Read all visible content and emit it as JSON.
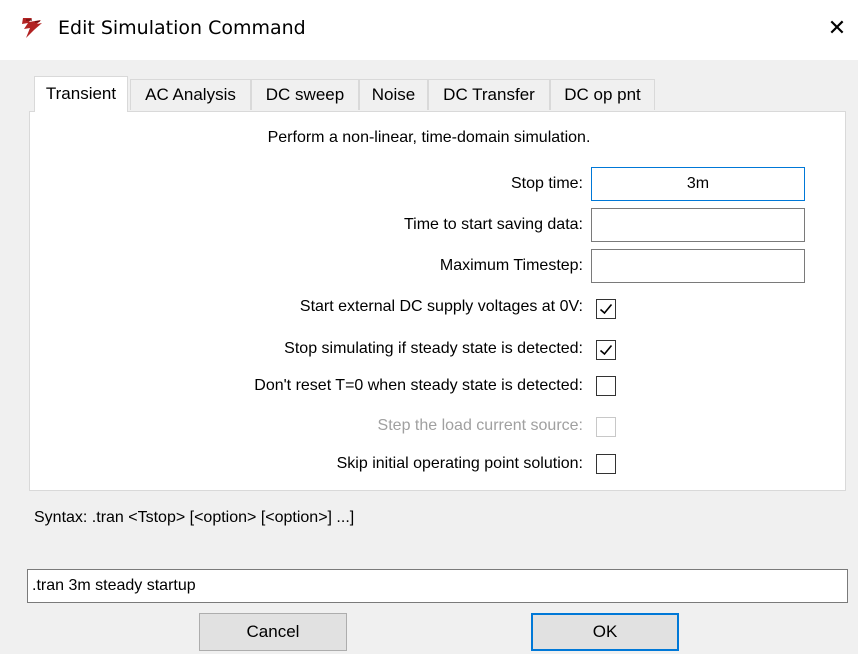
{
  "window": {
    "title": "Edit Simulation Command",
    "close_glyph": "✕"
  },
  "tabs": [
    {
      "label": "Transient",
      "active": true
    },
    {
      "label": "AC Analysis"
    },
    {
      "label": "DC sweep"
    },
    {
      "label": "Noise"
    },
    {
      "label": "DC Transfer"
    },
    {
      "label": "DC op pnt"
    }
  ],
  "transient": {
    "description": "Perform a non-linear, time-domain simulation.",
    "stop_time": {
      "label": "Stop time:",
      "value": "3m"
    },
    "start_save": {
      "label": "Time to start saving data:",
      "value": ""
    },
    "max_timestep": {
      "label": "Maximum Timestep:",
      "value": ""
    },
    "options": [
      {
        "label": "Start external DC supply voltages at 0V:",
        "checked": true,
        "enabled": true
      },
      {
        "label": "Stop simulating if steady state is detected:",
        "checked": true,
        "enabled": true
      },
      {
        "label": "Don't reset T=0 when steady state is detected:",
        "checked": false,
        "enabled": true
      },
      {
        "label": "Step the load current source:",
        "checked": false,
        "enabled": false
      },
      {
        "label": "Skip initial operating point solution:",
        "checked": false,
        "enabled": true
      }
    ]
  },
  "syntax": "Syntax:  .tran <Tstop> [<option> [<option>] ...]",
  "command": ".tran 3m steady startup",
  "buttons": {
    "cancel": "Cancel",
    "ok": "OK"
  },
  "colors": {
    "accent": "#0078d7",
    "disabled_text": "#a0a0a0",
    "logo_red": "#b22222"
  },
  "icons": {
    "app": "ltspice-logo-icon",
    "close": "close-icon",
    "check": "checkmark-icon"
  }
}
